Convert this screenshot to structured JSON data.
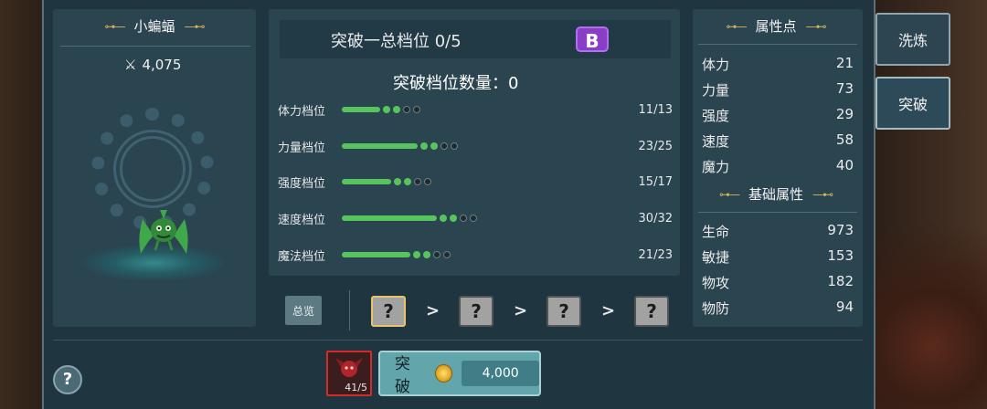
{
  "pet": {
    "name": "小蝙蝠",
    "power": "4,075"
  },
  "breakthrough": {
    "title": "突破一总档位 0/5",
    "grade": "B",
    "count_label": "突破档位数量：0"
  },
  "stats": [
    {
      "label": "体力档位",
      "value": "11/13",
      "bar_fraction": 0.4,
      "dots_on": 2,
      "dots_total": 4
    },
    {
      "label": "力量档位",
      "value": "23/25",
      "bar_fraction": 0.8,
      "dots_on": 2,
      "dots_total": 4
    },
    {
      "label": "强度档位",
      "value": "15/17",
      "bar_fraction": 0.52,
      "dots_on": 2,
      "dots_total": 4
    },
    {
      "label": "速度档位",
      "value": "30/32",
      "bar_fraction": 1.0,
      "dots_on": 2,
      "dots_total": 4
    },
    {
      "label": "魔法档位",
      "value": "21/23",
      "bar_fraction": 0.72,
      "dots_on": 2,
      "dots_total": 4
    }
  ],
  "overview_label": "总览",
  "slots": [
    "?",
    "?",
    "?",
    "?"
  ],
  "attr_points": {
    "title": "属性点",
    "rows": [
      {
        "label": "体力",
        "value": "21"
      },
      {
        "label": "力量",
        "value": "73"
      },
      {
        "label": "强度",
        "value": "29"
      },
      {
        "label": "速度",
        "value": "58"
      },
      {
        "label": "魔力",
        "value": "40"
      }
    ]
  },
  "base_attrs": {
    "title": "基础属性",
    "rows": [
      {
        "label": "生命",
        "value": "973"
      },
      {
        "label": "敏捷",
        "value": "153"
      },
      {
        "label": "物攻",
        "value": "182"
      },
      {
        "label": "物防",
        "value": "94"
      }
    ]
  },
  "tabs": {
    "refine": "洗炼",
    "breakthrough": "突破"
  },
  "help": "?",
  "item": {
    "count": "41/5"
  },
  "action": {
    "label": "突破",
    "cost": "4,000"
  },
  "colors": {
    "progress": "#58c45e",
    "grade_badge": "#8a3ec6",
    "item_border": "#d12a2a"
  }
}
